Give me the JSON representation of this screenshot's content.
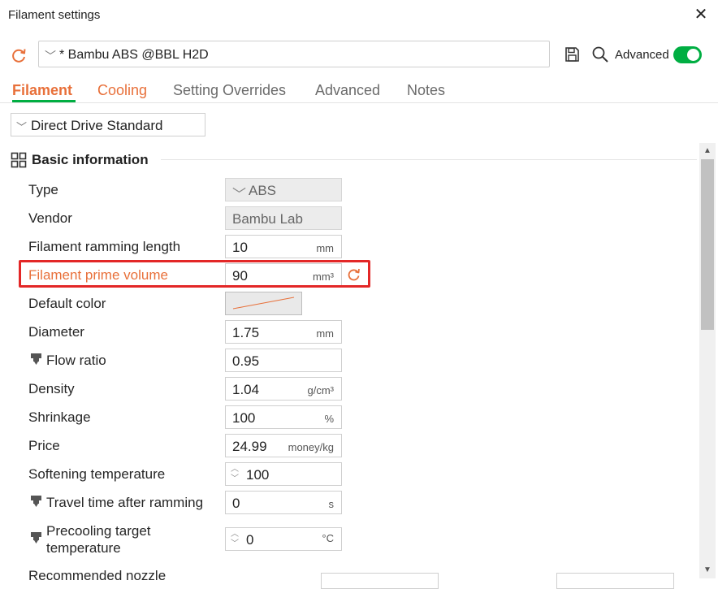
{
  "window": {
    "title": "Filament settings",
    "close_symbol": "✕"
  },
  "preset": {
    "name": "* Bambu ABS @BBL H2D",
    "chevron": "﹀"
  },
  "toolbar": {
    "advanced_label": "Advanced",
    "advanced_on": true
  },
  "tabs": [
    "Filament",
    "Cooling",
    "Setting Overrides",
    "Advanced",
    "Notes"
  ],
  "extruder": {
    "label": "Direct Drive Standard"
  },
  "section": {
    "title": "Basic information"
  },
  "rows": {
    "type": {
      "label": "Type",
      "value": "ABS"
    },
    "vendor": {
      "label": "Vendor",
      "value": "Bambu Lab"
    },
    "ramming_length": {
      "label": "Filament ramming length",
      "value": "10",
      "unit": "mm"
    },
    "prime_volume": {
      "label": "Filament prime volume",
      "value": "90",
      "unit": "mm³"
    },
    "default_color": {
      "label": "Default color"
    },
    "diameter": {
      "label": "Diameter",
      "value": "1.75",
      "unit": "mm"
    },
    "flow_ratio": {
      "label": "Flow ratio",
      "value": "0.95"
    },
    "density": {
      "label": "Density",
      "value": "1.04",
      "unit": "g/cm³"
    },
    "shrinkage": {
      "label": "Shrinkage",
      "value": "100",
      "unit": "%"
    },
    "price": {
      "label": "Price",
      "value": "24.99",
      "unit": "money/kg"
    },
    "softening_temp": {
      "label": "Softening temperature",
      "value": "100"
    },
    "travel_time": {
      "label": "Travel time after ramming",
      "value": "0",
      "unit": "s"
    },
    "precooling": {
      "label_line1": "Precooling target",
      "label_line2": "temperature",
      "value": "0",
      "unit": "°C"
    },
    "recommended_nozzle": {
      "label": "Recommended nozzle"
    }
  },
  "icons": {
    "reset": "reset-arrow-icon",
    "save": "save-disk-icon",
    "search": "search-icon",
    "section": "grid-icon",
    "nozzle": "nozzle-icon"
  },
  "colors": {
    "accent_orange": "#e8703a",
    "accent_green": "#00ae42",
    "highlight_red": "#e32727"
  }
}
